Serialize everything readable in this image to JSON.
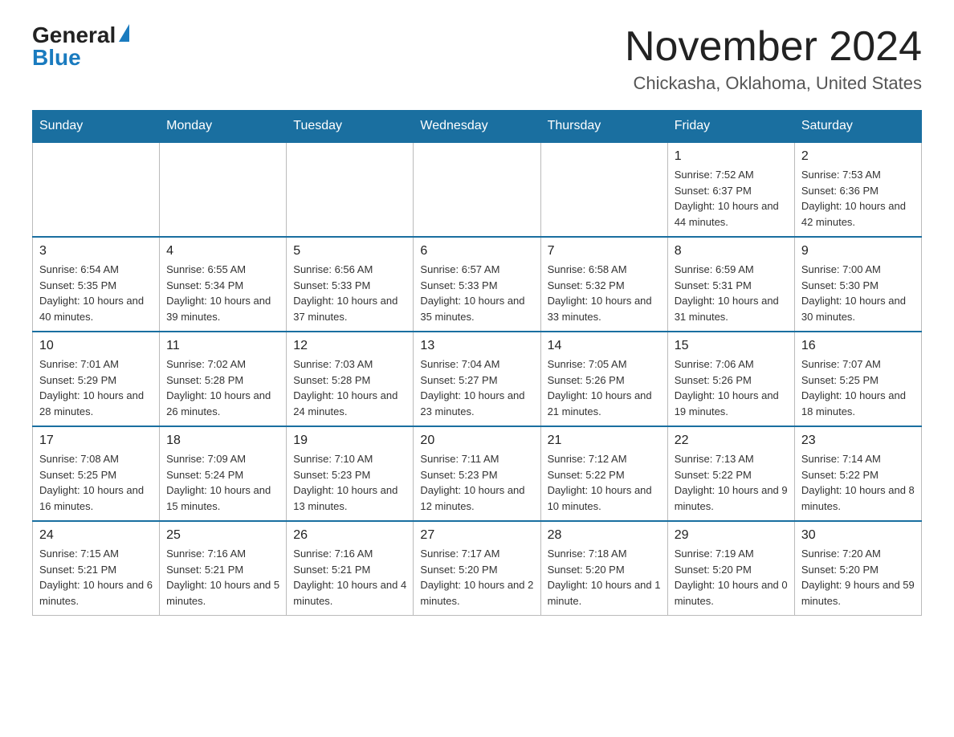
{
  "logo": {
    "general": "General",
    "blue": "Blue"
  },
  "title": "November 2024",
  "subtitle": "Chickasha, Oklahoma, United States",
  "days_of_week": [
    "Sunday",
    "Monday",
    "Tuesday",
    "Wednesday",
    "Thursday",
    "Friday",
    "Saturday"
  ],
  "weeks": [
    [
      {
        "day": "",
        "info": ""
      },
      {
        "day": "",
        "info": ""
      },
      {
        "day": "",
        "info": ""
      },
      {
        "day": "",
        "info": ""
      },
      {
        "day": "",
        "info": ""
      },
      {
        "day": "1",
        "info": "Sunrise: 7:52 AM\nSunset: 6:37 PM\nDaylight: 10 hours and 44 minutes."
      },
      {
        "day": "2",
        "info": "Sunrise: 7:53 AM\nSunset: 6:36 PM\nDaylight: 10 hours and 42 minutes."
      }
    ],
    [
      {
        "day": "3",
        "info": "Sunrise: 6:54 AM\nSunset: 5:35 PM\nDaylight: 10 hours and 40 minutes."
      },
      {
        "day": "4",
        "info": "Sunrise: 6:55 AM\nSunset: 5:34 PM\nDaylight: 10 hours and 39 minutes."
      },
      {
        "day": "5",
        "info": "Sunrise: 6:56 AM\nSunset: 5:33 PM\nDaylight: 10 hours and 37 minutes."
      },
      {
        "day": "6",
        "info": "Sunrise: 6:57 AM\nSunset: 5:33 PM\nDaylight: 10 hours and 35 minutes."
      },
      {
        "day": "7",
        "info": "Sunrise: 6:58 AM\nSunset: 5:32 PM\nDaylight: 10 hours and 33 minutes."
      },
      {
        "day": "8",
        "info": "Sunrise: 6:59 AM\nSunset: 5:31 PM\nDaylight: 10 hours and 31 minutes."
      },
      {
        "day": "9",
        "info": "Sunrise: 7:00 AM\nSunset: 5:30 PM\nDaylight: 10 hours and 30 minutes."
      }
    ],
    [
      {
        "day": "10",
        "info": "Sunrise: 7:01 AM\nSunset: 5:29 PM\nDaylight: 10 hours and 28 minutes."
      },
      {
        "day": "11",
        "info": "Sunrise: 7:02 AM\nSunset: 5:28 PM\nDaylight: 10 hours and 26 minutes."
      },
      {
        "day": "12",
        "info": "Sunrise: 7:03 AM\nSunset: 5:28 PM\nDaylight: 10 hours and 24 minutes."
      },
      {
        "day": "13",
        "info": "Sunrise: 7:04 AM\nSunset: 5:27 PM\nDaylight: 10 hours and 23 minutes."
      },
      {
        "day": "14",
        "info": "Sunrise: 7:05 AM\nSunset: 5:26 PM\nDaylight: 10 hours and 21 minutes."
      },
      {
        "day": "15",
        "info": "Sunrise: 7:06 AM\nSunset: 5:26 PM\nDaylight: 10 hours and 19 minutes."
      },
      {
        "day": "16",
        "info": "Sunrise: 7:07 AM\nSunset: 5:25 PM\nDaylight: 10 hours and 18 minutes."
      }
    ],
    [
      {
        "day": "17",
        "info": "Sunrise: 7:08 AM\nSunset: 5:25 PM\nDaylight: 10 hours and 16 minutes."
      },
      {
        "day": "18",
        "info": "Sunrise: 7:09 AM\nSunset: 5:24 PM\nDaylight: 10 hours and 15 minutes."
      },
      {
        "day": "19",
        "info": "Sunrise: 7:10 AM\nSunset: 5:23 PM\nDaylight: 10 hours and 13 minutes."
      },
      {
        "day": "20",
        "info": "Sunrise: 7:11 AM\nSunset: 5:23 PM\nDaylight: 10 hours and 12 minutes."
      },
      {
        "day": "21",
        "info": "Sunrise: 7:12 AM\nSunset: 5:22 PM\nDaylight: 10 hours and 10 minutes."
      },
      {
        "day": "22",
        "info": "Sunrise: 7:13 AM\nSunset: 5:22 PM\nDaylight: 10 hours and 9 minutes."
      },
      {
        "day": "23",
        "info": "Sunrise: 7:14 AM\nSunset: 5:22 PM\nDaylight: 10 hours and 8 minutes."
      }
    ],
    [
      {
        "day": "24",
        "info": "Sunrise: 7:15 AM\nSunset: 5:21 PM\nDaylight: 10 hours and 6 minutes."
      },
      {
        "day": "25",
        "info": "Sunrise: 7:16 AM\nSunset: 5:21 PM\nDaylight: 10 hours and 5 minutes."
      },
      {
        "day": "26",
        "info": "Sunrise: 7:16 AM\nSunset: 5:21 PM\nDaylight: 10 hours and 4 minutes."
      },
      {
        "day": "27",
        "info": "Sunrise: 7:17 AM\nSunset: 5:20 PM\nDaylight: 10 hours and 2 minutes."
      },
      {
        "day": "28",
        "info": "Sunrise: 7:18 AM\nSunset: 5:20 PM\nDaylight: 10 hours and 1 minute."
      },
      {
        "day": "29",
        "info": "Sunrise: 7:19 AM\nSunset: 5:20 PM\nDaylight: 10 hours and 0 minutes."
      },
      {
        "day": "30",
        "info": "Sunrise: 7:20 AM\nSunset: 5:20 PM\nDaylight: 9 hours and 59 minutes."
      }
    ]
  ]
}
